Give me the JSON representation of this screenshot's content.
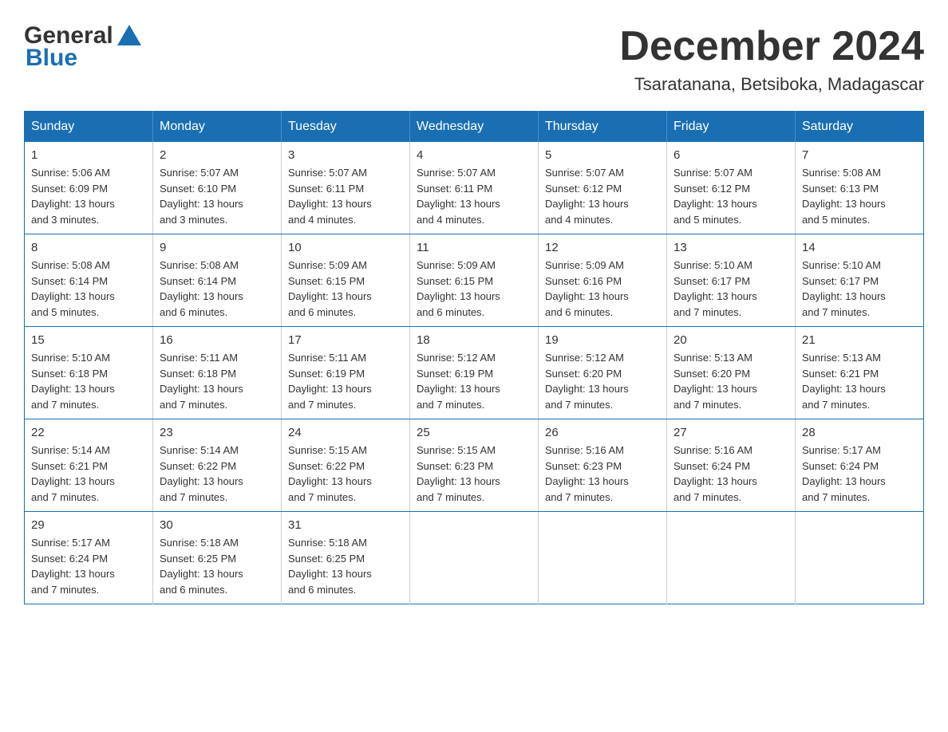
{
  "header": {
    "logo": {
      "general": "General",
      "blue": "Blue"
    },
    "title": "December 2024",
    "subtitle": "Tsaratanana, Betsiboka, Madagascar"
  },
  "weekdays": [
    "Sunday",
    "Monday",
    "Tuesday",
    "Wednesday",
    "Thursday",
    "Friday",
    "Saturday"
  ],
  "weeks": [
    [
      {
        "day": "1",
        "info": "Sunrise: 5:06 AM\nSunset: 6:09 PM\nDaylight: 13 hours\nand 3 minutes."
      },
      {
        "day": "2",
        "info": "Sunrise: 5:07 AM\nSunset: 6:10 PM\nDaylight: 13 hours\nand 3 minutes."
      },
      {
        "day": "3",
        "info": "Sunrise: 5:07 AM\nSunset: 6:11 PM\nDaylight: 13 hours\nand 4 minutes."
      },
      {
        "day": "4",
        "info": "Sunrise: 5:07 AM\nSunset: 6:11 PM\nDaylight: 13 hours\nand 4 minutes."
      },
      {
        "day": "5",
        "info": "Sunrise: 5:07 AM\nSunset: 6:12 PM\nDaylight: 13 hours\nand 4 minutes."
      },
      {
        "day": "6",
        "info": "Sunrise: 5:07 AM\nSunset: 6:12 PM\nDaylight: 13 hours\nand 5 minutes."
      },
      {
        "day": "7",
        "info": "Sunrise: 5:08 AM\nSunset: 6:13 PM\nDaylight: 13 hours\nand 5 minutes."
      }
    ],
    [
      {
        "day": "8",
        "info": "Sunrise: 5:08 AM\nSunset: 6:14 PM\nDaylight: 13 hours\nand 5 minutes."
      },
      {
        "day": "9",
        "info": "Sunrise: 5:08 AM\nSunset: 6:14 PM\nDaylight: 13 hours\nand 6 minutes."
      },
      {
        "day": "10",
        "info": "Sunrise: 5:09 AM\nSunset: 6:15 PM\nDaylight: 13 hours\nand 6 minutes."
      },
      {
        "day": "11",
        "info": "Sunrise: 5:09 AM\nSunset: 6:15 PM\nDaylight: 13 hours\nand 6 minutes."
      },
      {
        "day": "12",
        "info": "Sunrise: 5:09 AM\nSunset: 6:16 PM\nDaylight: 13 hours\nand 6 minutes."
      },
      {
        "day": "13",
        "info": "Sunrise: 5:10 AM\nSunset: 6:17 PM\nDaylight: 13 hours\nand 7 minutes."
      },
      {
        "day": "14",
        "info": "Sunrise: 5:10 AM\nSunset: 6:17 PM\nDaylight: 13 hours\nand 7 minutes."
      }
    ],
    [
      {
        "day": "15",
        "info": "Sunrise: 5:10 AM\nSunset: 6:18 PM\nDaylight: 13 hours\nand 7 minutes."
      },
      {
        "day": "16",
        "info": "Sunrise: 5:11 AM\nSunset: 6:18 PM\nDaylight: 13 hours\nand 7 minutes."
      },
      {
        "day": "17",
        "info": "Sunrise: 5:11 AM\nSunset: 6:19 PM\nDaylight: 13 hours\nand 7 minutes."
      },
      {
        "day": "18",
        "info": "Sunrise: 5:12 AM\nSunset: 6:19 PM\nDaylight: 13 hours\nand 7 minutes."
      },
      {
        "day": "19",
        "info": "Sunrise: 5:12 AM\nSunset: 6:20 PM\nDaylight: 13 hours\nand 7 minutes."
      },
      {
        "day": "20",
        "info": "Sunrise: 5:13 AM\nSunset: 6:20 PM\nDaylight: 13 hours\nand 7 minutes."
      },
      {
        "day": "21",
        "info": "Sunrise: 5:13 AM\nSunset: 6:21 PM\nDaylight: 13 hours\nand 7 minutes."
      }
    ],
    [
      {
        "day": "22",
        "info": "Sunrise: 5:14 AM\nSunset: 6:21 PM\nDaylight: 13 hours\nand 7 minutes."
      },
      {
        "day": "23",
        "info": "Sunrise: 5:14 AM\nSunset: 6:22 PM\nDaylight: 13 hours\nand 7 minutes."
      },
      {
        "day": "24",
        "info": "Sunrise: 5:15 AM\nSunset: 6:22 PM\nDaylight: 13 hours\nand 7 minutes."
      },
      {
        "day": "25",
        "info": "Sunrise: 5:15 AM\nSunset: 6:23 PM\nDaylight: 13 hours\nand 7 minutes."
      },
      {
        "day": "26",
        "info": "Sunrise: 5:16 AM\nSunset: 6:23 PM\nDaylight: 13 hours\nand 7 minutes."
      },
      {
        "day": "27",
        "info": "Sunrise: 5:16 AM\nSunset: 6:24 PM\nDaylight: 13 hours\nand 7 minutes."
      },
      {
        "day": "28",
        "info": "Sunrise: 5:17 AM\nSunset: 6:24 PM\nDaylight: 13 hours\nand 7 minutes."
      }
    ],
    [
      {
        "day": "29",
        "info": "Sunrise: 5:17 AM\nSunset: 6:24 PM\nDaylight: 13 hours\nand 7 minutes."
      },
      {
        "day": "30",
        "info": "Sunrise: 5:18 AM\nSunset: 6:25 PM\nDaylight: 13 hours\nand 6 minutes."
      },
      {
        "day": "31",
        "info": "Sunrise: 5:18 AM\nSunset: 6:25 PM\nDaylight: 13 hours\nand 6 minutes."
      },
      null,
      null,
      null,
      null
    ]
  ]
}
